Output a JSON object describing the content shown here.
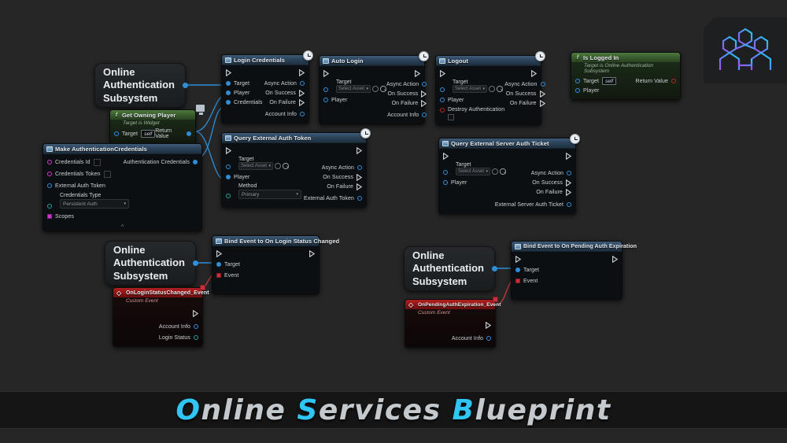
{
  "banner": {
    "title_parts": [
      {
        "t": "O",
        "hl": true
      },
      {
        "t": "nline ",
        "hl": false
      },
      {
        "t": "S",
        "hl": true
      },
      {
        "t": "ervices ",
        "hl": false
      },
      {
        "t": "B",
        "hl": true
      },
      {
        "t": "lueprint",
        "hl": false
      }
    ],
    "title_plain": "Online Services Blueprint",
    "accent_color": "#2fc6f3",
    "text_color": "#c4c9cd"
  },
  "logo": {
    "name": "online-services-logo",
    "gradient_from": "#a84ff0",
    "gradient_to": "#22d3ee"
  },
  "canvas": {
    "background": "#262626"
  },
  "subsystems": [
    {
      "name": "subsystem-node-1",
      "label_lines": [
        "Online",
        "Authentication",
        "Subsystem"
      ]
    },
    {
      "name": "subsystem-node-2",
      "label_lines": [
        "Online",
        "Authentication",
        "Subsystem"
      ]
    },
    {
      "name": "subsystem-node-3",
      "label_lines": [
        "Online",
        "Authentication",
        "Subsystem"
      ]
    }
  ],
  "nodes": {
    "login_credentials": {
      "title": "Login Credentials",
      "inputs": [
        "Target",
        "Player",
        "Credentials"
      ],
      "outputs": [
        "Async Action",
        "On Success",
        "On Failure",
        "Account Info"
      ]
    },
    "auto_login": {
      "title": "Auto Login",
      "target_label": "Target",
      "target_value": "Select Asset",
      "player_label": "Player",
      "outputs": [
        "Async Action",
        "On Success",
        "On Failure",
        "Account Info"
      ]
    },
    "logout": {
      "title": "Logout",
      "target_label": "Target",
      "target_value": "Select Asset",
      "player_label": "Player",
      "destroy_label": "Destroy Authentication",
      "outputs": [
        "Async Action",
        "On Success",
        "On Failure"
      ]
    },
    "is_logged_in": {
      "title": "Is Logged In",
      "subtitle": "Target is Online Authentication Subsystem",
      "target_label": "Target",
      "target_value": "self",
      "player_label": "Player",
      "return_label": "Return Value"
    },
    "get_owning_player": {
      "title": "Get Owning Player",
      "subtitle": "Target is Widget",
      "target_label": "Target",
      "target_value": "self",
      "return_label": "Return Value"
    },
    "make_credentials": {
      "title": "Make AuthenticationCredentials",
      "fields": [
        {
          "label": "Credentials Id",
          "widget": "textbox"
        },
        {
          "label": "Credentials Token",
          "widget": "textbox"
        },
        {
          "label": "External Auth Token",
          "widget": "none"
        }
      ],
      "type_label": "Credentials Type",
      "type_value": "Persistent Auth",
      "scopes_label": "Scopes",
      "output_label": "Authentication Credentials"
    },
    "query_external_auth_token": {
      "title": "Query External Auth Token",
      "target_label": "Target",
      "target_value": "Select Asset",
      "player_label": "Player",
      "method_label": "Method",
      "method_value": "Primary",
      "outputs": [
        "Async Action",
        "On Success",
        "On Failure",
        "External Auth Token"
      ]
    },
    "query_external_server_auth_ticket": {
      "title": "Query External Server Auth Ticket",
      "target_label": "Target",
      "target_value": "Select Asset",
      "player_label": "Player",
      "outputs": [
        "Async Action",
        "On Success",
        "On Failure",
        "External Server Auth Ticket"
      ]
    },
    "bind_login_status": {
      "title": "Bind Event to On Login Status Changed",
      "target_label": "Target",
      "event_label": "Event"
    },
    "bind_pending_expiration": {
      "title": "Bind Event to On Pending Auth Expiration",
      "target_label": "Target",
      "event_label": "Event"
    },
    "on_login_status_changed_event": {
      "title": "OnLoginStatusChanged_Event",
      "subtitle": "Custom Event",
      "outputs": [
        "Account Info",
        "Login Status"
      ]
    },
    "on_pending_auth_expiration_event": {
      "title": "OnPendingAuthExpiration_Event",
      "subtitle": "Custom Event",
      "outputs": [
        "Account Info"
      ]
    }
  }
}
